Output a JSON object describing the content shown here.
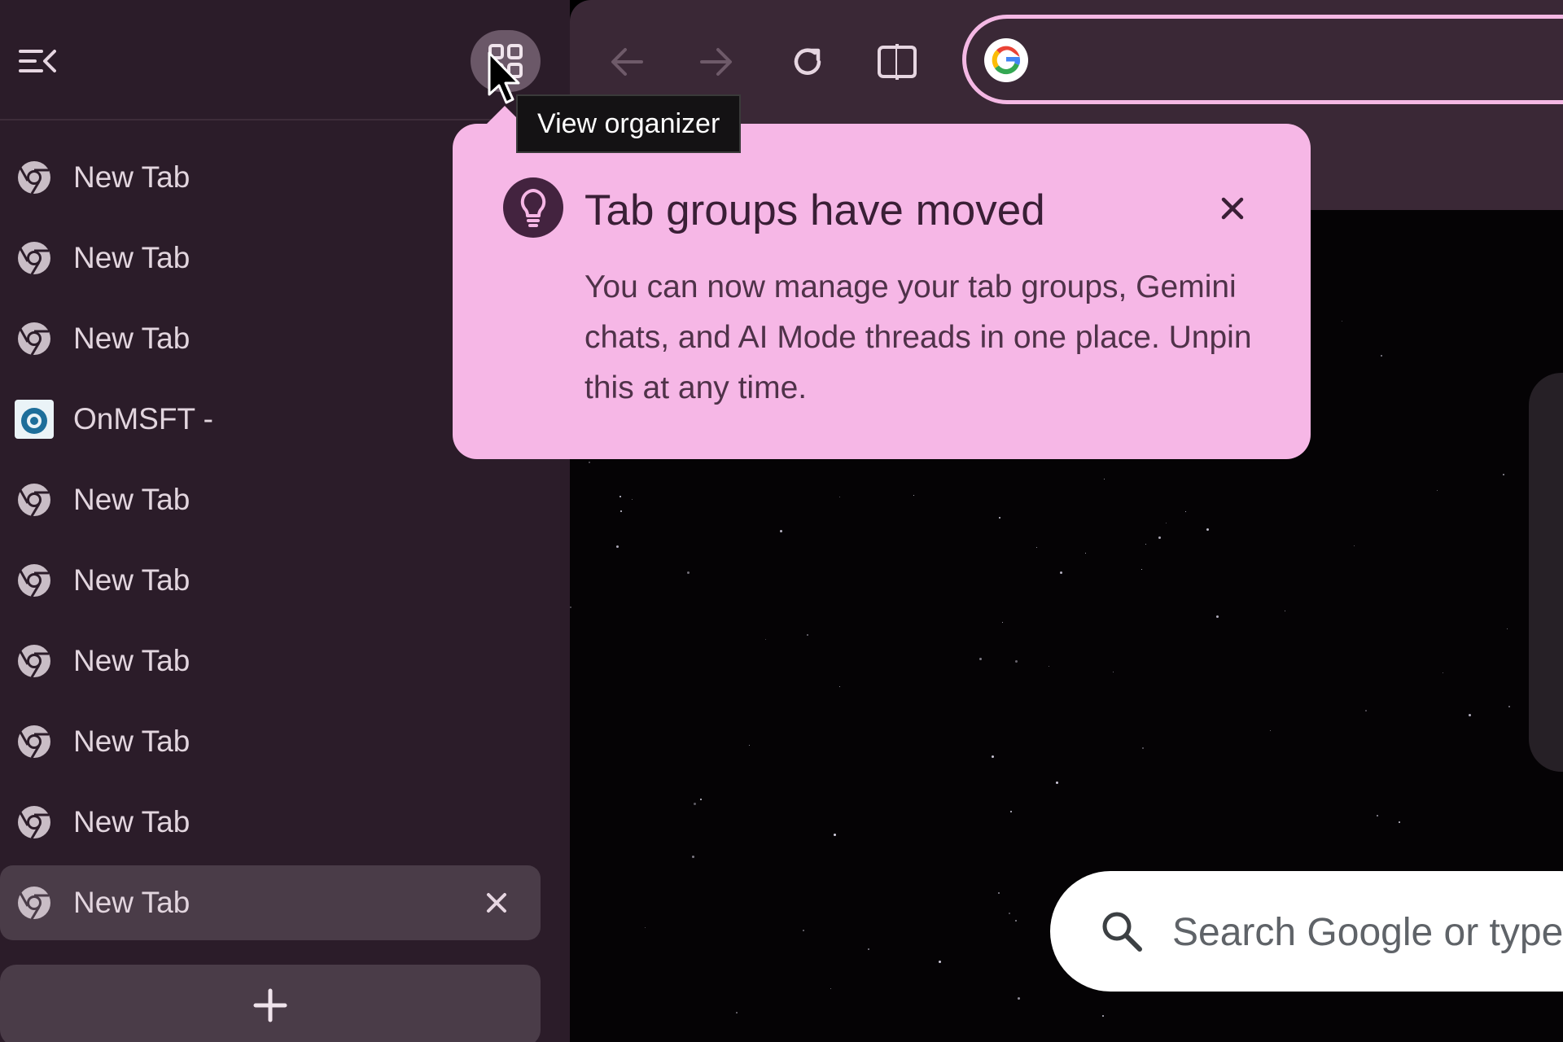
{
  "sidebar": {
    "collapse_icon": "menu-collapse-icon",
    "organizer_icon": "grid-icon",
    "tabs": [
      {
        "label": "New Tab",
        "icon": "chrome-icon"
      },
      {
        "label": "New Tab",
        "icon": "chrome-icon"
      },
      {
        "label": "New Tab",
        "icon": "chrome-icon"
      },
      {
        "label": "OnMSFT -",
        "icon": "onmsft-favicon"
      },
      {
        "label": "New Tab",
        "icon": "chrome-icon"
      },
      {
        "label": "New Tab",
        "icon": "chrome-icon"
      },
      {
        "label": "New Tab",
        "icon": "chrome-icon"
      },
      {
        "label": "New Tab",
        "icon": "chrome-icon"
      },
      {
        "label": "New Tab",
        "icon": "chrome-icon"
      },
      {
        "label": "New Tab",
        "icon": "chrome-icon",
        "active": true
      }
    ],
    "new_tab_icon": "plus-icon"
  },
  "tooltip": {
    "text": "View organizer"
  },
  "callout": {
    "icon": "lightbulb-icon",
    "title": "Tab groups have moved",
    "body": "You can now manage your tab groups, Gemini chats, and AI Mode threads in one place. Unpin this at any time."
  },
  "toolbar": {
    "icons": [
      "back-icon",
      "forward-icon",
      "reload-icon",
      "split-view-icon",
      "google-icon"
    ]
  },
  "ntp": {
    "search_placeholder": "Search Google or type"
  },
  "colors": {
    "sidebar_bg": "#2b1c29",
    "toolbar_bg": "#3a2836",
    "callout_bg": "#f6b7e6",
    "omnibox_border": "#f4b8e4"
  }
}
